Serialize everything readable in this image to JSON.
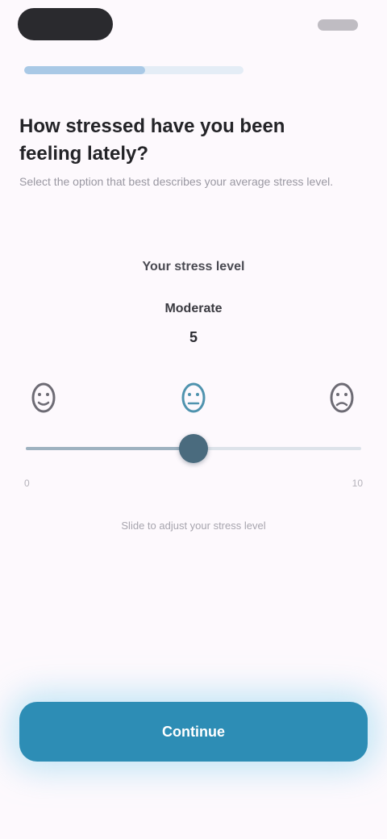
{
  "progress": {
    "fraction": 0.55
  },
  "question": {
    "title": "How stressed have you been feeling lately?",
    "subtitle": "Select the option that best describes your average stress level."
  },
  "scale": {
    "heading": "Your stress level",
    "value_label": "Moderate",
    "value": 5,
    "min": 0,
    "max": 10,
    "min_label": "0",
    "max_label": "10",
    "hint": "Slide to adjust your stress level",
    "faces": [
      "calm-face-icon",
      "neutral-face-icon",
      "stressed-face-icon"
    ]
  },
  "footer": {
    "continue_label": "Continue"
  },
  "colors": {
    "accent": "#2d8db5",
    "thumb": "#4a6b7e",
    "background": "#fdf9fd"
  }
}
